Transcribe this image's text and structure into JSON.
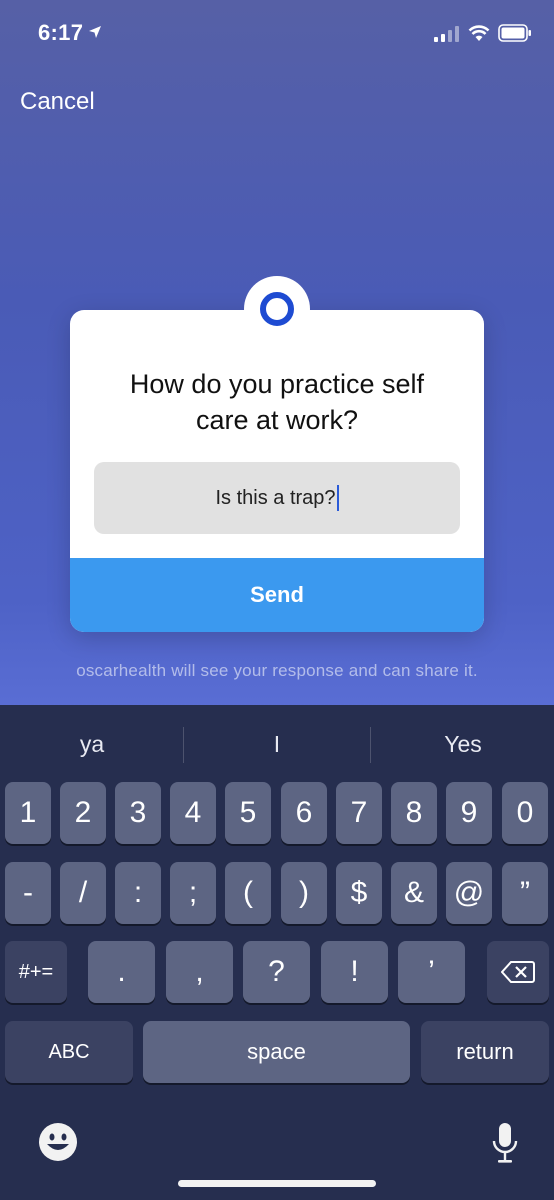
{
  "status_bar": {
    "time": "6:17"
  },
  "header": {
    "cancel_label": "Cancel"
  },
  "card": {
    "question": "How do you practice self care at work?",
    "answer_value": "Is this a trap?",
    "send_label": "Send"
  },
  "share_note": "oscarhealth will see your response and can share it.",
  "keyboard": {
    "suggestions": [
      "ya",
      "I",
      "Yes"
    ],
    "row1": [
      "1",
      "2",
      "3",
      "4",
      "5",
      "6",
      "7",
      "8",
      "9",
      "0"
    ],
    "row2": [
      "-",
      "/",
      ":",
      ";",
      "(",
      ")",
      "$",
      "&",
      "@",
      "”"
    ],
    "row3_left": "#+=",
    "row3": [
      ".",
      ",",
      "?",
      "!",
      "’"
    ],
    "abc_label": "ABC",
    "space_label": "space",
    "return_label": "return"
  },
  "colors": {
    "accent": "#3b99ef",
    "logo": "#1e4bd2"
  },
  "icons": [
    "location-icon",
    "signal-icon",
    "wifi-icon",
    "battery-icon",
    "backspace-icon",
    "emoji-icon",
    "microphone-icon"
  ]
}
